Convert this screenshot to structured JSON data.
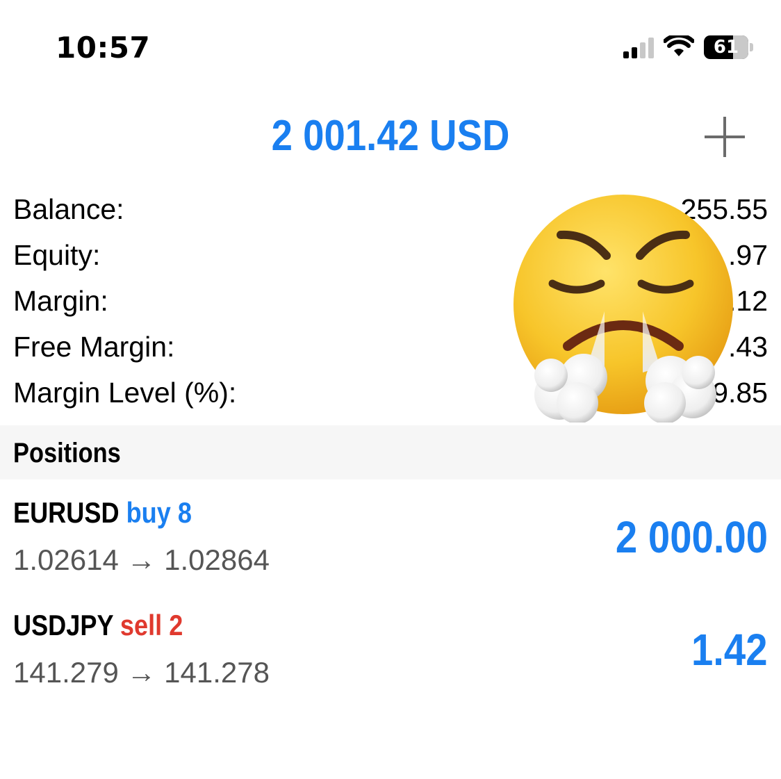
{
  "status_bar": {
    "time": "10:57",
    "battery": "61",
    "icons": [
      "signal-icon",
      "wifi-icon",
      "battery-icon"
    ]
  },
  "header": {
    "total": "2 001.42 USD",
    "add_icon": "plus-icon"
  },
  "summary": [
    {
      "label": "Balance:",
      "value": "255.55"
    },
    {
      "label": "Equity:",
      "value": ".97"
    },
    {
      "label": "Margin:",
      "value": ".12"
    },
    {
      "label": "Free Margin:",
      "value": ".43"
    },
    {
      "label": "Margin Level (%):",
      "value": "9.85"
    }
  ],
  "overlay": {
    "emoji": "face-with-steam-from-nose"
  },
  "positions": {
    "title": "Positions",
    "items": [
      {
        "symbol": "EURUSD",
        "side": "buy 8",
        "prices": "1.02614 → 1.02864",
        "profit": "2 000.00"
      },
      {
        "symbol": "USDJPY",
        "side": "sell 2",
        "prices": "141.279 → 141.278",
        "profit": "1.42"
      }
    ]
  },
  "colors": {
    "accent": "#1a7ff0",
    "sell": "#e0392e",
    "section_bg": "#f6f6f6",
    "emoji_yellow": "#f7c52a"
  }
}
